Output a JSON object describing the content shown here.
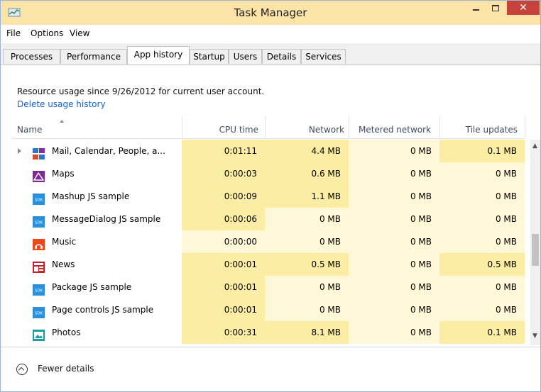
{
  "window": {
    "title": "Task Manager",
    "close_label": "✕"
  },
  "menu": [
    "File",
    "Options",
    "View"
  ],
  "tabs": [
    "Processes",
    "Performance",
    "App history",
    "Startup",
    "Users",
    "Details",
    "Services"
  ],
  "active_tab": "App history",
  "info_text": "Resource usage since 9/26/2012 for current user account.",
  "delete_link": "Delete usage history",
  "columns": {
    "name": "Name",
    "cpu": "CPU time",
    "network": "Network",
    "metered": "Metered network",
    "tiles": "Tile updates"
  },
  "rows": [
    {
      "name": "Mail, Calendar, People, a...",
      "icon": "mail-calendar-people-icon",
      "expandable": true,
      "cpu": "0:01:11",
      "network": "4.4 MB",
      "metered": "0 MB",
      "tiles": "0.1 MB"
    },
    {
      "name": "Maps",
      "icon": "maps-icon",
      "expandable": false,
      "cpu": "0:00:03",
      "network": "0.6 MB",
      "metered": "0 MB",
      "tiles": "0 MB"
    },
    {
      "name": "Mashup JS sample",
      "icon": "sdk-icon",
      "expandable": false,
      "cpu": "0:00:09",
      "network": "1.1 MB",
      "metered": "0 MB",
      "tiles": "0 MB"
    },
    {
      "name": "MessageDialog JS sample",
      "icon": "sdk-icon",
      "expandable": false,
      "cpu": "0:00:06",
      "network": "0 MB",
      "metered": "0 MB",
      "tiles": "0 MB"
    },
    {
      "name": "Music",
      "icon": "music-icon",
      "expandable": false,
      "cpu": "0:00:00",
      "network": "0 MB",
      "metered": "0 MB",
      "tiles": "0 MB"
    },
    {
      "name": "News",
      "icon": "news-icon",
      "expandable": false,
      "cpu": "0:00:01",
      "network": "0.5 MB",
      "metered": "0 MB",
      "tiles": "0.5 MB"
    },
    {
      "name": "Package JS sample",
      "icon": "sdk-icon",
      "expandable": false,
      "cpu": "0:00:01",
      "network": "0 MB",
      "metered": "0 MB",
      "tiles": "0 MB"
    },
    {
      "name": "Page controls JS sample",
      "icon": "sdk-icon",
      "expandable": false,
      "cpu": "0:00:01",
      "network": "0 MB",
      "metered": "0 MB",
      "tiles": "0 MB"
    },
    {
      "name": "Photos",
      "icon": "photos-icon",
      "expandable": false,
      "cpu": "0:00:31",
      "network": "8.1 MB",
      "metered": "0 MB",
      "tiles": "0.1 MB"
    }
  ],
  "footer": {
    "fewer_details": "Fewer details"
  },
  "colors": {
    "heat_high": "#fbeea4",
    "heat_low": "#fdf6d0",
    "link": "#1a62c6",
    "titlebar": "#fce3a8",
    "close": "#c7423b"
  }
}
